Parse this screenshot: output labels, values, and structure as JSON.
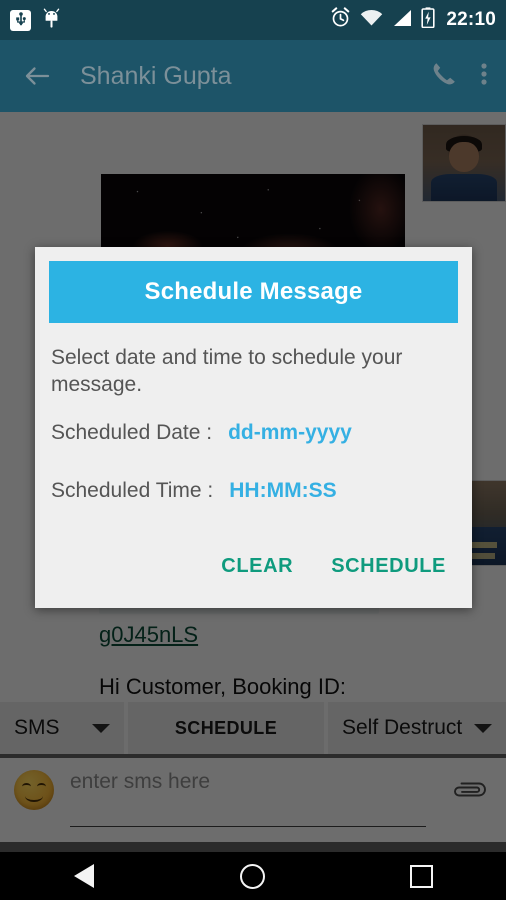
{
  "status_bar": {
    "time": "22:10",
    "icons": [
      "usb-icon",
      "android-bug-icon",
      "alarm-icon",
      "wifi-icon",
      "signal-icon",
      "battery-charging-icon"
    ]
  },
  "app_bar": {
    "back_icon": "back-arrow-icon",
    "title": "Shanki Gupta",
    "call_icon": "phone-icon",
    "overflow_icon": "overflow-menu-icon"
  },
  "chat": {
    "link_text": "g0J45nLS",
    "message_text": "Hi Customer, Booking ID:",
    "attachments": [
      "contact-photo",
      "space-nebula-photo",
      "contact-photo-partial"
    ]
  },
  "dialog": {
    "title": "Schedule Message",
    "description": "Select date and time to schedule your message.",
    "fields": [
      {
        "label": "Scheduled Date :",
        "value": "dd-mm-yyyy"
      },
      {
        "label": "Scheduled Time :",
        "value": "HH:MM:SS"
      }
    ],
    "buttons": {
      "clear": "CLEAR",
      "schedule": "SCHEDULE"
    },
    "colors": {
      "header_blue": "#2cb3e3",
      "value_blue": "#35b0e3",
      "action_green": "#0f9b7e",
      "surface": "#efefef"
    }
  },
  "toolbar": {
    "type_selector": "SMS",
    "schedule_button": "SCHEDULE",
    "destruct_selector": "Self Destruct",
    "dropdown_icon": "chevron-down-icon"
  },
  "compose": {
    "emoji_icon": "emoji-smiley-icon",
    "placeholder": "enter sms here",
    "value": "",
    "attach_icon": "paperclip-icon"
  },
  "nav_bar": {
    "back": "nav-back-icon",
    "home": "nav-home-icon",
    "recents": "nav-recents-icon"
  }
}
